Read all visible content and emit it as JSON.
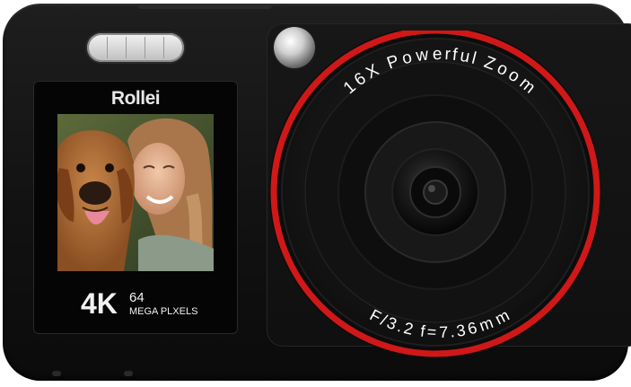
{
  "camera": {
    "brand": "Rollei",
    "spec_resolution": "4K",
    "spec_megapixels": "64",
    "spec_megapixel_label": "MEGA PLXELS",
    "lens_top_text": "16X Powerful Zoom",
    "lens_bottom_text": "F/3.2 f=7.36mm",
    "accent_color": "#d01818",
    "body_color": "#151515"
  },
  "screen_photo": {
    "subject": "woman-with-dog-icon"
  }
}
